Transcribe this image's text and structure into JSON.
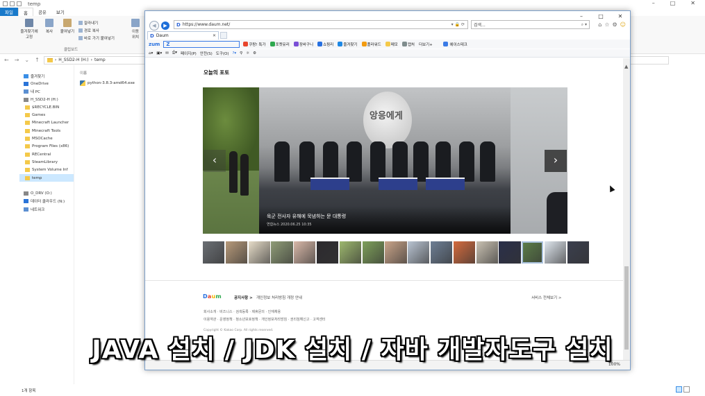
{
  "explorer": {
    "title": "temp",
    "tabs": [
      "파일",
      "홈",
      "공유",
      "보기"
    ],
    "ribbon": {
      "pin_label": "즐겨찾기에\n고정",
      "copy_label": "복사",
      "paste_label": "붙여넣기",
      "cut_label": "잘라내기",
      "copy_path_label": "경로 복사",
      "paste_shortcut_label": "바로 가기 붙여넣기",
      "move_label": "이동\n위치",
      "clipboard_group": "클립보드"
    },
    "path": [
      "H_SSD2-H (H:)",
      "temp"
    ],
    "sidebar": [
      {
        "label": "즐겨찾기",
        "level": "top",
        "color": "#3a8ee6"
      },
      {
        "label": "OneDrive",
        "level": "top",
        "color": "#2a74d8"
      },
      {
        "label": "내 PC",
        "level": "top",
        "color": "#5b8fd1"
      },
      {
        "label": "H_SSD2-H (H:)",
        "level": "top",
        "color": "#888888"
      },
      {
        "label": "$RECYCLE.BIN",
        "level": "sub",
        "color": "#f4c94a"
      },
      {
        "label": "Games",
        "level": "sub",
        "color": "#f4c94a"
      },
      {
        "label": "Minecraft Launcher",
        "level": "sub",
        "color": "#f4c94a"
      },
      {
        "label": "Minecraft Tools",
        "level": "sub",
        "color": "#f4c94a"
      },
      {
        "label": "MSOCache",
        "level": "sub",
        "color": "#f4c94a"
      },
      {
        "label": "Program Files (x86)",
        "level": "sub",
        "color": "#f4c94a"
      },
      {
        "label": "RECentral",
        "level": "sub",
        "color": "#f4c94a"
      },
      {
        "label": "SteamLibrary",
        "level": "sub",
        "color": "#f4c94a"
      },
      {
        "label": "System Volume Inf",
        "level": "sub",
        "color": "#f4c94a"
      },
      {
        "label": "temp",
        "level": "sub",
        "color": "#f4c94a",
        "selected": true
      },
      {
        "label": "",
        "level": "gap",
        "color": ""
      },
      {
        "label": "O_DRV (O:)",
        "level": "top",
        "color": "#888888"
      },
      {
        "label": "데이터 클라우드 (N:)",
        "level": "top",
        "color": "#2a74d8"
      },
      {
        "label": "네트워크",
        "level": "top",
        "color": "#5b8fd1"
      }
    ],
    "column_header": "이름",
    "files": [
      {
        "name": "python-3.8.3-amd64.exe"
      }
    ],
    "status": "1개 항목"
  },
  "ie": {
    "url": "https://www.daum.net/",
    "search_placeholder": "검색...",
    "tab_title": "Daum",
    "toolbar1": {
      "zum": "zum",
      "zum_input": "Z",
      "items": [
        {
          "label": "쿠팡! 특가",
          "color": "#e8452c"
        },
        {
          "label": "포켓유리",
          "color": "#2fa84f"
        },
        {
          "label": "장바구니",
          "color": "#7a4fd6"
        },
        {
          "label": "쇼핑리",
          "color": "#2770e0"
        },
        {
          "label": "즐겨찾기",
          "color": "#1e88e5"
        },
        {
          "label": "플라워드",
          "color": "#f39c12"
        },
        {
          "label": "메모",
          "color": "#f4c94a"
        },
        {
          "label": "캡처",
          "color": "#7f8c8d"
        },
        {
          "label": "더보기+",
          "color": ""
        }
      ],
      "extra": "에이스테크"
    },
    "toolbar2": [
      "페이지(P)",
      "안전(S)",
      "도구(O)"
    ],
    "zoom": "100%"
  },
  "page": {
    "section_title": "오늘의 포토",
    "balloon_text": "앙응에게",
    "main_caption": "육군 전사자 유해에 묵념하는 문 대통령",
    "main_meta": "연합뉴스   2020.06.25 10:35",
    "thumb_colors": [
      "#6b6f74",
      "#b79a7a",
      "#e6dcc8",
      "#8f9c77",
      "#d8b8a8",
      "#2c2a2e",
      "#9db86e",
      "#7ea05a",
      "#c9a489",
      "#b9c4d2",
      "#6e7f95",
      "#d46b3e",
      "#c9c1b2",
      "#2a2f4a",
      "#5d7f49",
      "#dfe6ee",
      "#3b3f4e"
    ],
    "thumb_selected": 14,
    "footer": {
      "logo": [
        "D",
        "a",
        "u",
        "m"
      ],
      "logo_colors": [
        "#2770e0",
        "#e8452c",
        "#f4b400",
        "#2fa84f"
      ],
      "notice_label": "공지사항 >",
      "notice_text": "개인정보 처리방침 개정 안내",
      "all_services": "서비스 전체보기 >",
      "row1": "회사소개 · 비즈니스 · 검색등록 · 제휴문의 · 인재채용",
      "row2": "이용약관 · 운영정책 · 청소년보호정책 · 개인정보처리방침 · 권리침해신고 · 고객센터",
      "copyright": "Copyright © Kakao Corp. All rights reserved."
    }
  },
  "overlay_text": "JAVA 설치 / JDK 설치 / 자바 개발자도구 설치"
}
